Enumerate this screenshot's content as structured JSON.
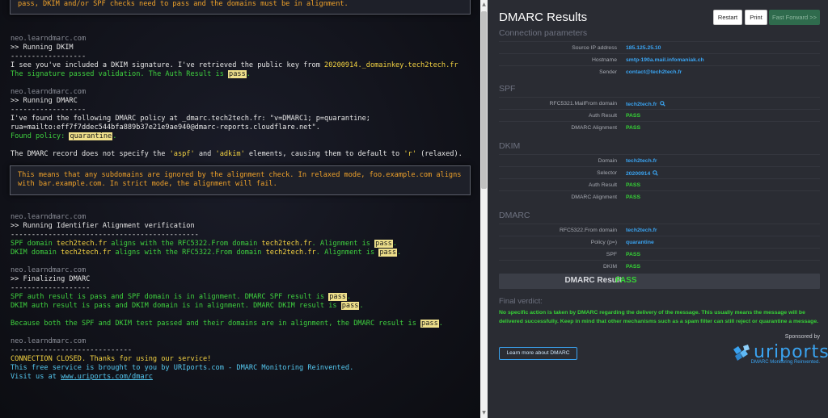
{
  "terminal": {
    "top_box": "pass, DKIM and/or SPF checks need to pass and the domains must be in alignment.",
    "host": "neo.learndmarc.com",
    "dkim": {
      "heading": ">> Running DKIM",
      "sep": "------------------",
      "line1_a": "I see you've included a DKIM signature. I've retrieved the public key from ",
      "line1_key": "20200914._domainkey.tech2tech.fr",
      "line2_a": "The signature passed validation. The Auth Result is ",
      "line2_pass": "pass",
      "line2_b": "."
    },
    "dmarc": {
      "heading": ">> Running DMARC",
      "sep": "------------------",
      "policy_line1": "I've found the following DMARC policy at _dmarc.tech2tech.fr: \"v=DMARC1; p=quarantine;",
      "policy_line2": "rua=mailto:eff7f7ddec544bfa889b37e21e9ae940@dmarc-reports.cloudflare.net\".",
      "found_label": "Found policy: ",
      "found_value": "quarantine",
      "found_end": ".",
      "record_a": "The DMARC record does not specify the ",
      "record_aspf": "'aspf'",
      "record_and": " and ",
      "record_adkim": "'adkim'",
      "record_b": " elements, causing them to default to ",
      "record_r": "'r'",
      "record_c": " (relaxed).",
      "info_box": "This means that any subdomains are ignored by the alignment check. In relaxed mode, foo.example.com aligns with bar.example.com. In strict mode, the alignment will fail."
    },
    "align": {
      "heading": ">> Running Identifier Alignment verification",
      "sep": "---------------------------------------------",
      "spf_a": "SPF domain ",
      "spf_d1": "tech2tech.fr",
      "spf_b": " aligns with the RFC5322.From domain ",
      "spf_d2": "tech2tech.fr",
      "spf_c": ". Alignment is ",
      "spf_pass": "pass",
      "dkim_a": "DKIM domain ",
      "dkim_d1": "tech2tech.fr",
      "dkim_b": " aligns with the RFC5322.From domain ",
      "dkim_d2": "tech2tech.fr",
      "dkim_c": ". Alignment is ",
      "dkim_pass": "pass",
      "end": "."
    },
    "final": {
      "heading": ">> Finalizing DMARC",
      "sep": "-------------------",
      "spf_line": "SPF auth result is pass and SPF domain is in alignment. DMARC SPF result is ",
      "dkim_line": "DKIM auth result is pass and DKIM domain is in alignment. DMARC DKIM result is ",
      "both_line": "Because both the SPF and DKIM test passed and their domains are in alignment, the DMARC result is ",
      "pass": "pass",
      "end": "."
    },
    "closing": {
      "sep": "-----------------------------",
      "closed": "CONNECTION CLOSED. Thanks for using our service!",
      "brought": "This free service is brought to you by URIports.com - DMARC Monitoring Reinvented.",
      "visit_a": "Visit us at ",
      "visit_link": "www.uriports.com/dmarc"
    }
  },
  "results": {
    "title": "DMARC Results",
    "buttons": {
      "restart": "Restart",
      "print": "Print",
      "fast_forward": "Fast Forward >>"
    },
    "connection": {
      "heading": "Connection parameters",
      "rows": [
        {
          "key": "Source IP address",
          "value": "185.125.25.10"
        },
        {
          "key": "Hostname",
          "value": "smtp-190a.mail.infomaniak.ch"
        },
        {
          "key": "Sender",
          "value": "contact@tech2tech.fr"
        }
      ]
    },
    "spf": {
      "heading": "SPF",
      "rows": [
        {
          "key": "RFC5321.MailFrom domain",
          "value": "tech2tech.fr"
        },
        {
          "key": "Auth Result",
          "value": "PASS"
        },
        {
          "key": "DMARC Alignment",
          "value": "PASS"
        }
      ]
    },
    "dkim": {
      "heading": "DKIM",
      "rows": [
        {
          "key": "Domain",
          "value": "tech2tech.fr"
        },
        {
          "key": "Selector",
          "value": "20200914"
        },
        {
          "key": "Auth Result",
          "value": "PASS"
        },
        {
          "key": "DMARC Alignment",
          "value": "PASS"
        }
      ]
    },
    "dmarc": {
      "heading": "DMARC",
      "rows": [
        {
          "key": "RFC5322.From domain",
          "value": "tech2tech.fr"
        },
        {
          "key": "Policy (p=)",
          "value": "quarantine"
        },
        {
          "key": "SPF",
          "value": "PASS"
        },
        {
          "key": "DKIM",
          "value": "PASS"
        }
      ]
    },
    "final_result": {
      "label": "DMARC Result",
      "value": "PASS"
    },
    "verdict": {
      "heading": "Final verdict:",
      "text": "No specific action is taken by DMARC regarding the delivery of the message. This usually means the message will be delivered successfully. Keep in mind that other mechanisms such as a spam filter can still reject or quarantine a message."
    },
    "learn_more": "Learn more about DMARC",
    "sponsored": "Sponsored by",
    "logo_text": "uriports",
    "tagline": "DMARC Monitoring Reinvented."
  },
  "colors": {
    "terminal_bg": "#101118",
    "panel_bg": "#2a2c33",
    "pass_green": "#36d336",
    "link_blue": "#3aa3f0",
    "warning_orange": "#f0a22a",
    "highlight_yellow": "#efe08b"
  }
}
